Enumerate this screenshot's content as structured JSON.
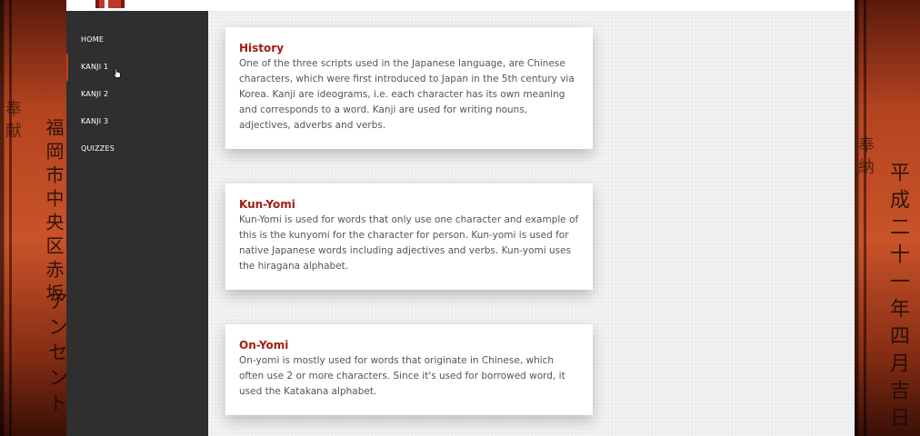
{
  "background": {
    "left_kanji_a": "福岡市中央区赤坂",
    "left_kanji_b": "アンセント",
    "left_kanji_c": "奉献",
    "right_kanji_a": "平成二十一年四月吉日",
    "right_kanji_b": "奉納"
  },
  "colors": {
    "sidebar": "#2f2f2f",
    "accent": "#a21d12",
    "active_indicator": "#c0392b"
  },
  "nav": {
    "items": [
      {
        "label": "HOME"
      },
      {
        "label": "KANJI 1"
      },
      {
        "label": "KANJI 2"
      },
      {
        "label": "KANJI 3"
      },
      {
        "label": "QUIZZES"
      }
    ],
    "active": "KANJI 1"
  },
  "cards": [
    {
      "title": "History",
      "body": "One of the three scripts used in the Japanese language, are Chinese characters, which were first introduced to Japan in the 5th century via Korea. Kanji are ideograms, i.e. each character has its own meaning and corresponds to a word. Kanji are used for writing nouns, adjectives, adverbs and verbs."
    },
    {
      "title": "Kun-Yomi",
      "body": "Kun-Yomi is used for words that only use one character and example of this is the kunyomi for the character for person. Kun-yomi is used for native Japanese words including adjectives and verbs. Kun-yomi uses the hiragana alphabet."
    },
    {
      "title": "On-Yomi",
      "body": "On-yomi is mostly used for words that originate in Chinese, which often use 2 or more characters. Since it's used for borrowed word, it used the Katakana alphabet."
    }
  ]
}
